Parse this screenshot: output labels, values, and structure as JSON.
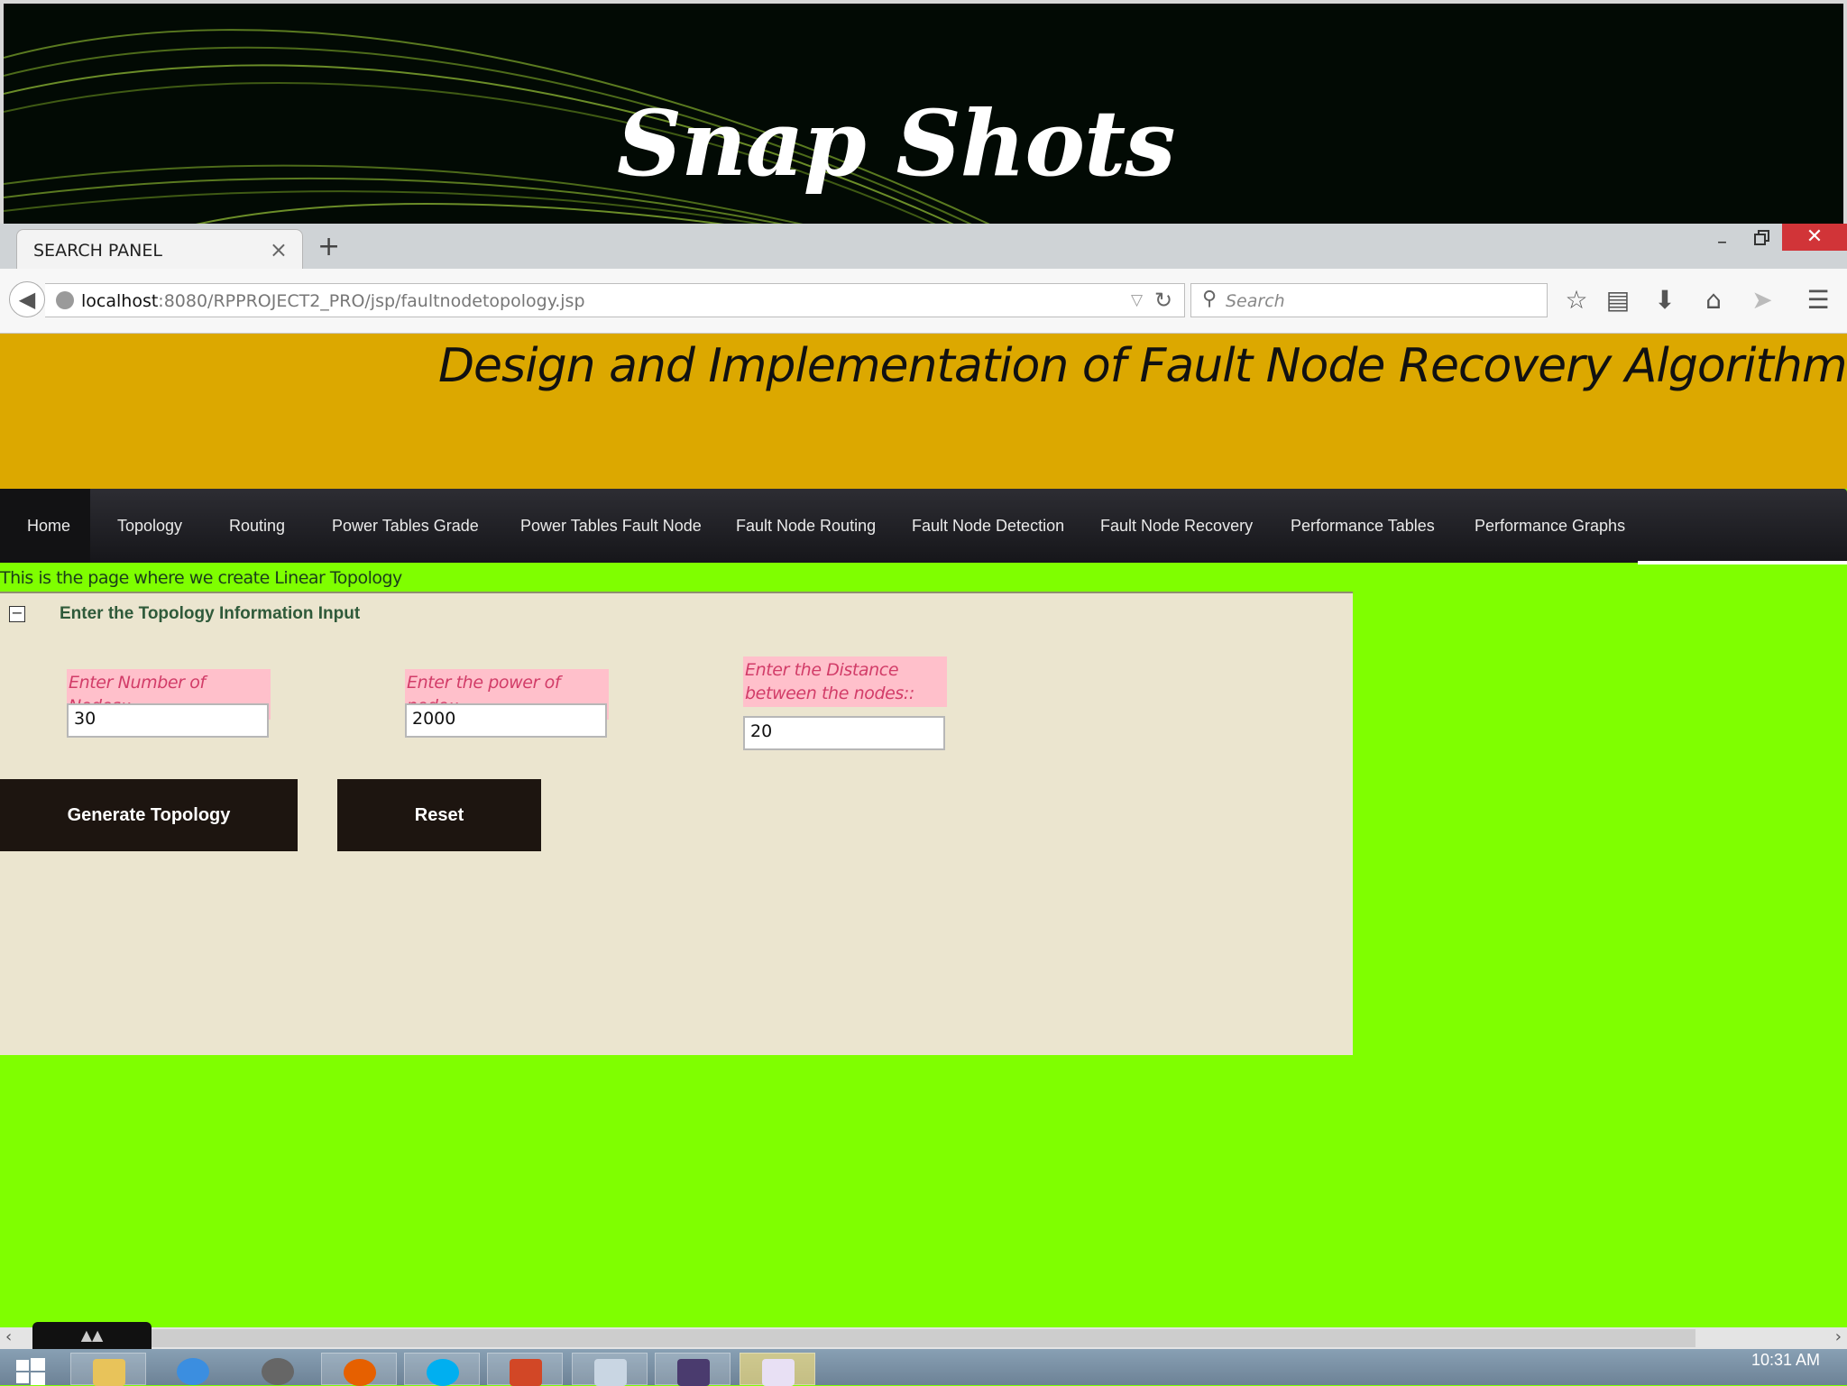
{
  "slide": {
    "title": "Snap Shots"
  },
  "browser": {
    "tab_label": "SEARCH PANEL",
    "tab_close": "×",
    "new_tab": "+",
    "url_host": "localhost",
    "url_path": ":8080/RPPROJECT2_PRO/jsp/faultnodetopology.jsp",
    "search_placeholder": "Search",
    "window_minimize": "–",
    "window_close": "✕"
  },
  "page": {
    "banner_title": "Design and Implementation of Fault Node Recovery Algorithm",
    "menu": [
      {
        "label": "Home"
      },
      {
        "label": "Topology"
      },
      {
        "label": "Routing"
      },
      {
        "label": "Power Tables Grade"
      },
      {
        "label": "Power Tables Fault Node"
      },
      {
        "label": "Fault Node Routing"
      },
      {
        "label": "Fault Node Detection"
      },
      {
        "label": "Fault Node Recovery"
      },
      {
        "label": "Performance Tables"
      },
      {
        "label": "Performance Graphs"
      }
    ],
    "intro_text": "This is the page where we create Linear Topology",
    "panel": {
      "title": "Enter the Topology Information Input",
      "collapse_symbol": "−",
      "fields": [
        {
          "label": "Enter Number of Nodes::",
          "value": "30"
        },
        {
          "label": "Enter the power of node::",
          "value": "2000"
        },
        {
          "label": "Enter the Distance between the nodes::",
          "value": "20"
        }
      ],
      "generate_button": "Generate Topology",
      "reset_button": "Reset"
    }
  },
  "taskbar": {
    "clock": "10:31 AM"
  }
}
